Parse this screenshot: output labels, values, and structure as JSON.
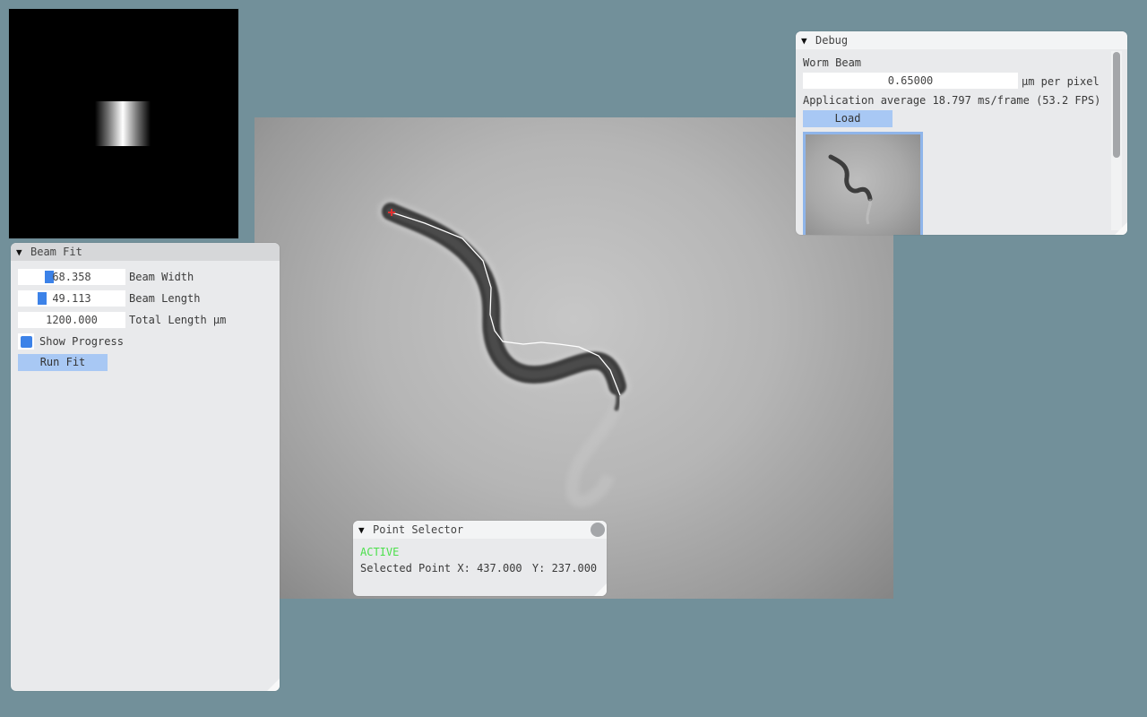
{
  "beam_preview": {},
  "main_image": {},
  "beam_fit": {
    "title": "Beam Fit",
    "beam_width_value": "68.358",
    "beam_width_fill": 0.27,
    "beam_width_label": "Beam Width",
    "beam_length_value": "49.113",
    "beam_length_fill": 0.21,
    "beam_length_label": "Beam Length",
    "total_length_value": "1200.000",
    "total_length_label": "Total Length µm",
    "show_progress_label": "Show Progress",
    "show_progress_checked": true,
    "run_fit_label": "Run Fit"
  },
  "debug": {
    "title": "Debug",
    "section_label": "Worm Beam",
    "scale_value": "0.65000",
    "scale_unit": "µm per pixel",
    "perf_text": "Application average 18.797 ms/frame (53.2 FPS)",
    "load_label": "Load"
  },
  "point_selector": {
    "title": "Point Selector",
    "status": "ACTIVE",
    "status_color": "#4be04b",
    "selected_label": "Selected Point",
    "x_label": "X:",
    "x_value": "437.000",
    "y_label": "Y:",
    "y_value": "237.000"
  },
  "colors": {
    "background": "#72909a",
    "accent": "#3c82e8",
    "button": "#a8c8f4",
    "selected_point": "#e03030"
  }
}
